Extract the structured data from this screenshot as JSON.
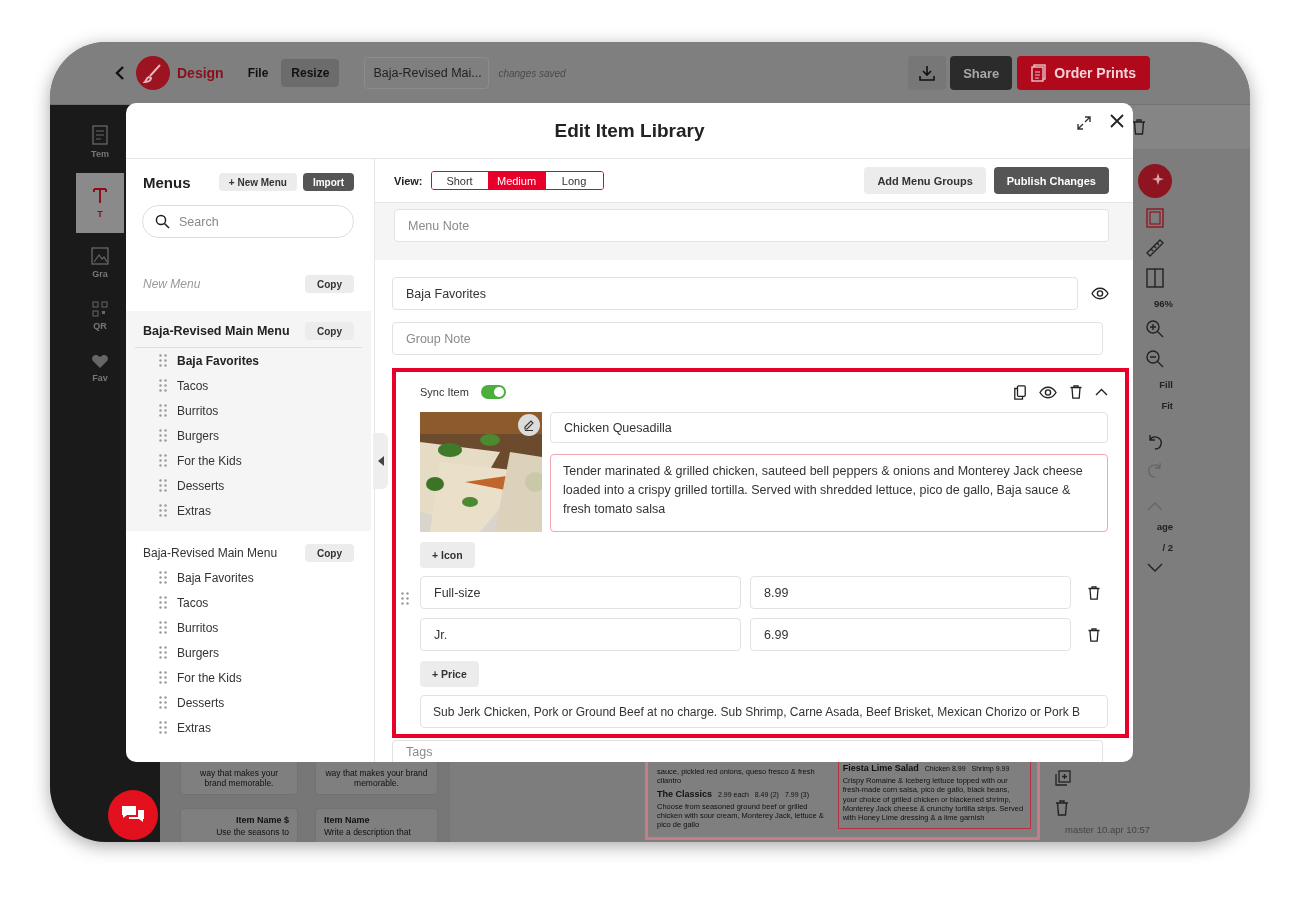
{
  "app_bar": {
    "logo_label": "Design",
    "menu": [
      {
        "label": "File",
        "selected": false
      },
      {
        "label": "Resize",
        "selected": true
      }
    ],
    "document_name": "Baja-Revised Mai...",
    "save_status": "changes saved",
    "share": "Share",
    "order_prints": "Order Prints"
  },
  "sidebar": {
    "items": [
      {
        "label": "Tem",
        "kind": "templates",
        "selected": false
      },
      {
        "label": "T",
        "kind": "text",
        "selected": true
      },
      {
        "label": "Gra",
        "kind": "graphics",
        "selected": false
      },
      {
        "label": "QR",
        "kind": "qr",
        "selected": false
      },
      {
        "label": "Fav",
        "kind": "favorites",
        "selected": false
      }
    ]
  },
  "canvas": {
    "cards": [
      {
        "text": "way that makes your brand memorable."
      },
      {
        "text": "way that makes your brand memorable."
      },
      {
        "title": "Item Name $",
        "text": "Use the seasons to"
      },
      {
        "title": "Item Name",
        "text": "Write a description that"
      }
    ],
    "menu_preview": {
      "left": [
        {
          "kind": "text",
          "text": "sauce, pickled red onions, queso fresco & fresh cilantro"
        },
        {
          "kind": "heading",
          "name": "The Classics",
          "prices": [
            "2.99 each",
            "8.49 (2)",
            "7.99 (3)"
          ]
        },
        {
          "kind": "text",
          "text": "Choose from seasoned ground beef or grilled chicken with sour cream, Monterey Jack, lettuce & pico de gallo"
        }
      ],
      "right": [
        {
          "kind": "heading",
          "name": "Fiesta Lime Salad",
          "prices": [
            "Chicken 8.99",
            "Shrimp 9.99"
          ]
        },
        {
          "kind": "text",
          "text": "Crispy Romaine & Iceberg lettuce topped with our fresh-made corn salsa, pico de gallo, black beans, your choice of grilled chicken or blackened shrimp, Monterey Jack cheese & crunchy tortilla strips. Served with Honey Lime dressing & a lime garnish"
        }
      ]
    },
    "tools": {
      "zoom": "96%",
      "fill": "Fill",
      "fit": "Fit",
      "page": "age",
      "page_count": "/ 2"
    },
    "version": "master 10.apr 10:57"
  },
  "modal": {
    "title": "Edit Item Library",
    "menus_panel": {
      "title": "Menus",
      "new_menu": "+ New Menu",
      "import": "Import",
      "search_placeholder": "Search",
      "menus": [
        {
          "name": "New Menu",
          "kind": "draft",
          "copy": "Copy",
          "selected": false
        },
        {
          "name": "Baja-Revised Main Menu",
          "kind": "saved",
          "copy": "Copy",
          "selected": true,
          "groups": [
            {
              "label": "Baja Favorites",
              "selected": true
            },
            {
              "label": "Tacos",
              "selected": false
            },
            {
              "label": "Burritos",
              "selected": false
            },
            {
              "label": "Burgers",
              "selected": false
            },
            {
              "label": "For the Kids",
              "selected": false
            },
            {
              "label": "Desserts",
              "selected": false
            },
            {
              "label": "Extras",
              "selected": false
            }
          ]
        },
        {
          "name": "Baja-Revised Main Menu",
          "kind": "saved",
          "copy": "Copy",
          "selected": false,
          "groups": [
            {
              "label": "Baja Favorites",
              "selected": false
            },
            {
              "label": "Tacos",
              "selected": false
            },
            {
              "label": "Burritos",
              "selected": false
            },
            {
              "label": "Burgers",
              "selected": false
            },
            {
              "label": "For the Kids",
              "selected": false
            },
            {
              "label": "Desserts",
              "selected": false
            },
            {
              "label": "Extras",
              "selected": false
            }
          ]
        }
      ]
    },
    "editor": {
      "view_label": "View:",
      "views": [
        {
          "label": "Short",
          "selected": false
        },
        {
          "label": "Medium",
          "selected": true
        },
        {
          "label": "Long",
          "selected": false
        }
      ],
      "add_groups": "Add Menu Groups",
      "publish": "Publish Changes",
      "menu_note_placeholder": "Menu Note",
      "group_name": "Baja Favorites",
      "group_note_placeholder": "Group Note",
      "item": {
        "sync_label": "Sync Item",
        "sync_on": true,
        "name": "Chicken Quesadilla",
        "description": "Tender marinated & grilled chicken, sauteed bell peppers & onions and Monterey Jack cheese loaded into a crispy grilled tortilla. Served with shredded lettuce, pico de gallo, Baja sauce & fresh tomato salsa",
        "add_icon": "+ Icon",
        "prices": [
          {
            "size": "Full-size",
            "price": "8.99"
          },
          {
            "size": "Jr.",
            "price": "6.99"
          }
        ],
        "add_price": "+ Price",
        "note": "Sub Jerk Chicken, Pork or Ground Beef at no charge. Sub Shrimp, Carne Asada, Beef Brisket, Mexican Chorizo or Pork B"
      },
      "tags_placeholder": "Tags"
    }
  }
}
